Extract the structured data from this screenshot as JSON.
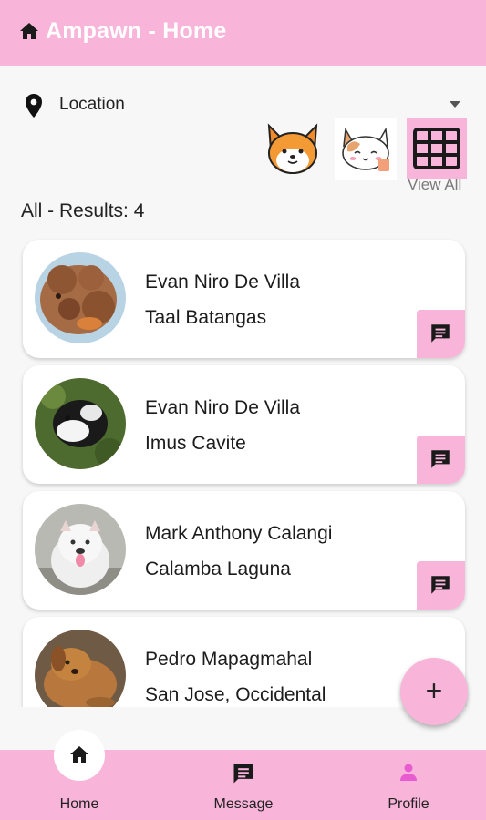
{
  "appbar": {
    "title": "Ampawn - Home"
  },
  "location": {
    "label": "Location"
  },
  "categories": {
    "view_all": "View All"
  },
  "results_text": "All - Results: 4",
  "listings": [
    {
      "name": "Evan Niro De Villa",
      "place": "Taal Batangas"
    },
    {
      "name": "Evan Niro De Villa",
      "place": "Imus Cavite"
    },
    {
      "name": "Mark Anthony Calangi",
      "place": "Calamba Laguna"
    },
    {
      "name": "Pedro Mapagmahal",
      "place": "San Jose, Occidental Mindoro"
    }
  ],
  "fab": {
    "label": "+"
  },
  "nav": [
    {
      "label": "Home",
      "icon": "home-icon"
    },
    {
      "label": "Message",
      "icon": "chat-icon"
    },
    {
      "label": "Profile",
      "icon": "person-icon"
    }
  ],
  "colors": {
    "primary": "#f8b4d9",
    "background": "#f7f7f7",
    "profile_icon": "#e85bd1"
  }
}
